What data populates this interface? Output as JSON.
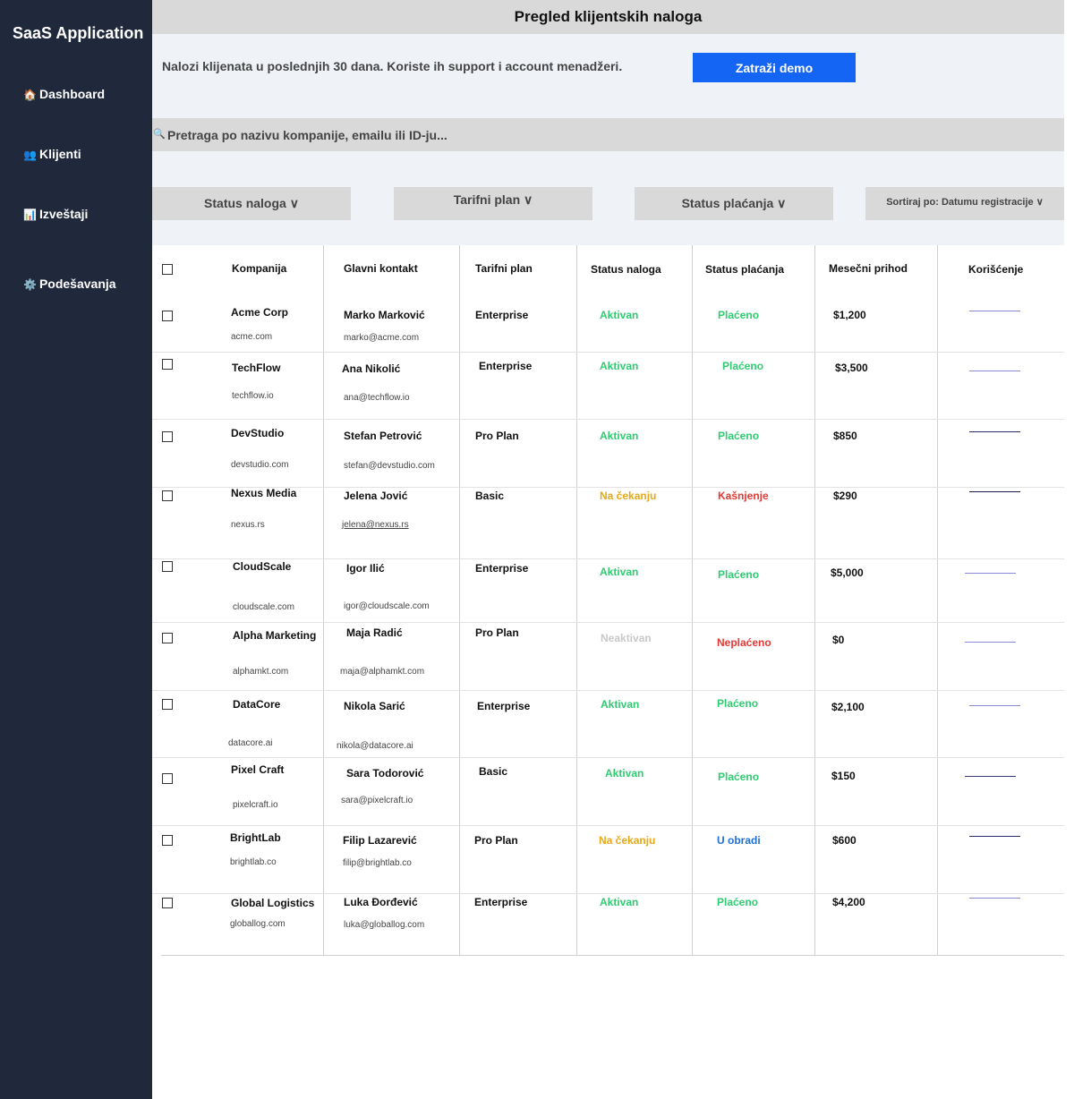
{
  "sidebar": {
    "app_title": "SaaS Application",
    "items": [
      {
        "icon": "🏠",
        "label": "Dashboard"
      },
      {
        "icon": "👥",
        "label": "Klijenti"
      },
      {
        "icon": "📊",
        "label": "Izveštaji"
      },
      {
        "icon": "⚙️",
        "label": "Podešavanja"
      }
    ]
  },
  "header": {
    "title": "Pregled klijentskih naloga"
  },
  "intro": {
    "text": "Nalozi klijenata u poslednjih 30 dana. Koriste ih support i account menadžeri.",
    "demo_button": "Zatraži demo"
  },
  "search": {
    "icon": "🔍",
    "placeholder": "Pretraga po nazivu kompanije, emailu ili ID-ju..."
  },
  "filters": {
    "account_status": "Status naloga ∨",
    "plan": "Tarifni plan ∨",
    "payment_status": "Status plaćanja ∨",
    "sort": "Sortiraj po: Datumu registracije ∨"
  },
  "table": {
    "headers": [
      "Kompanija",
      "Glavni kontakt",
      "Tarifni plan",
      "Status naloga",
      "Status plaćanja",
      "Mesečni prihod",
      "Korišćenje"
    ],
    "rows": [
      {
        "company": "Acme Corp",
        "domain": "acme.com",
        "contact": "Marko Marković",
        "email": "marko@acme.com",
        "plan": "Enterprise",
        "status": "Aktivan",
        "status_color": "#2ecc71",
        "payment": "Plaćeno",
        "payment_color": "#2ecc71",
        "revenue": "$1,200",
        "usage_color": "#8a8ad8"
      },
      {
        "company": "TechFlow",
        "domain": "techflow.io",
        "contact": "Ana Nikolić",
        "email": "ana@techflow.io",
        "plan": "Enterprise",
        "status": "Aktivan",
        "status_color": "#2ecc71",
        "payment": "Plaćeno",
        "payment_color": "#2ecc71",
        "revenue": "$3,500",
        "usage_color": "#8a8ad8"
      },
      {
        "company": "DevStudio",
        "domain": "devstudio.com",
        "contact": "Stefan Petrović",
        "email": "stefan@devstudio.com",
        "plan": "Pro Plan",
        "status": "Aktivan",
        "status_color": "#2ecc71",
        "payment": "Plaćeno",
        "payment_color": "#2ecc71",
        "revenue": "$850",
        "usage_color": "#2a2a6a"
      },
      {
        "company": "Nexus Media",
        "domain": "nexus.rs",
        "contact": "Jelena Jović",
        "email": "jelena@nexus.rs",
        "plan": "Basic",
        "status": "Na čekanju",
        "status_color": "#e6a817",
        "payment": "Kašnjenje",
        "payment_color": "#e53935",
        "revenue": "$290",
        "usage_color": "#1a1a4a"
      },
      {
        "company": "CloudScale",
        "domain": "cloudscale.com",
        "contact": "Igor Ilić",
        "email": "igor@cloudscale.com",
        "plan": "Enterprise",
        "status": "Aktivan",
        "status_color": "#2ecc71",
        "payment": "Plaćeno",
        "payment_color": "#2ecc71",
        "revenue": "$5,000",
        "usage_color": "#8a8ad8"
      },
      {
        "company": "Alpha Marketing",
        "domain": "alphamkt.com",
        "contact": "Maja Radić",
        "email": "maja@alphamkt.com",
        "plan": "Pro Plan",
        "status": "Neaktivan",
        "status_color": "#c8c8c8",
        "payment": "Neplaćeno",
        "payment_color": "#e53935",
        "revenue": "$0",
        "usage_color": "#8a8ad8"
      },
      {
        "company": "DataCore",
        "domain": "datacore.ai",
        "contact": "Nikola Sarić",
        "email": "nikola@datacore.ai",
        "plan": "Enterprise",
        "status": "Aktivan",
        "status_color": "#2ecc71",
        "payment": "Plaćeno",
        "payment_color": "#2ecc71",
        "revenue": "$2,100",
        "usage_color": "#8a8ad8"
      },
      {
        "company": "Pixel Craft",
        "domain": "pixelcraft.io",
        "contact": "Sara Todorović",
        "email": "sara@pixelcraft.io",
        "plan": "Basic",
        "status": "Aktivan",
        "status_color": "#2ecc71",
        "payment": "Plaćeno",
        "payment_color": "#2ecc71",
        "revenue": "$150",
        "usage_color": "#3a3a7a"
      },
      {
        "company": "BrightLab",
        "domain": "brightlab.co",
        "contact": "Filip Lazarević",
        "email": "filip@brightlab.co",
        "plan": "Pro Plan",
        "status": "Na čekanju",
        "status_color": "#e6a817",
        "payment": "U obradi",
        "payment_color": "#1e6fd9",
        "revenue": "$600",
        "usage_color": "#2a2a6a"
      },
      {
        "company": "Global Logistics",
        "domain": "globallog.com",
        "contact": "Luka Đorđević",
        "email": "luka@globallog.com",
        "plan": "Enterprise",
        "status": "Aktivan",
        "status_color": "#2ecc71",
        "payment": "Plaćeno",
        "payment_color": "#2ecc71",
        "revenue": "$4,200",
        "usage_color": "#8a8ad8"
      }
    ]
  }
}
